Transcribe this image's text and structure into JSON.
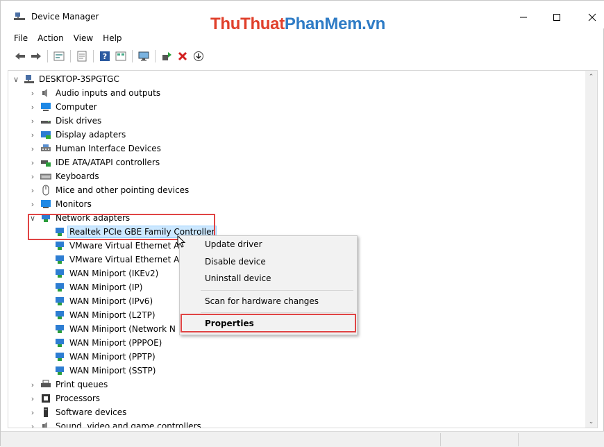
{
  "window": {
    "title": "Device Manager",
    "watermark_part1": "ThuThuat",
    "watermark_part2": "PhanMem.vn"
  },
  "menu": [
    "File",
    "Action",
    "View",
    "Help"
  ],
  "toolbar": {
    "icons": [
      "back-arrow-icon",
      "forward-arrow-icon",
      "properties-icon",
      "show-hide-icon",
      "help-icon",
      "view-icon",
      "monitor-icon",
      "update-driver-icon",
      "uninstall-icon",
      "scan-hardware-icon"
    ]
  },
  "tree": {
    "root": "DESKTOP-3SPGTGC",
    "categories": [
      {
        "label": "Audio inputs and outputs",
        "icon": "speaker-icon",
        "expanded": false
      },
      {
        "label": "Computer",
        "icon": "computer-icon",
        "expanded": false
      },
      {
        "label": "Disk drives",
        "icon": "disk-drive-icon",
        "expanded": false
      },
      {
        "label": "Display adapters",
        "icon": "display-adapter-icon",
        "expanded": false
      },
      {
        "label": "Human Interface Devices",
        "icon": "hid-icon",
        "expanded": false
      },
      {
        "label": "IDE ATA/ATAPI controllers",
        "icon": "ide-controller-icon",
        "expanded": false
      },
      {
        "label": "Keyboards",
        "icon": "keyboard-icon",
        "expanded": false
      },
      {
        "label": "Mice and other pointing devices",
        "icon": "mouse-icon",
        "expanded": false
      },
      {
        "label": "Monitors",
        "icon": "monitor-icon",
        "expanded": false
      },
      {
        "label": "Network adapters",
        "icon": "network-adapter-icon",
        "expanded": true
      }
    ],
    "network_adapters": [
      {
        "label": "Realtek PCIe GBE Family Controller",
        "selected": true
      },
      {
        "label": "VMware Virtual Ethernet A",
        "selected": false
      },
      {
        "label": "VMware Virtual Ethernet A",
        "selected": false
      },
      {
        "label": "WAN Miniport (IKEv2)",
        "selected": false
      },
      {
        "label": "WAN Miniport (IP)",
        "selected": false
      },
      {
        "label": "WAN Miniport (IPv6)",
        "selected": false
      },
      {
        "label": "WAN Miniport (L2TP)",
        "selected": false
      },
      {
        "label": "WAN Miniport (Network N",
        "selected": false
      },
      {
        "label": "WAN Miniport (PPPOE)",
        "selected": false
      },
      {
        "label": "WAN Miniport (PPTP)",
        "selected": false
      },
      {
        "label": "WAN Miniport (SSTP)",
        "selected": false
      }
    ],
    "categories_after": [
      {
        "label": "Print queues",
        "icon": "printer-icon"
      },
      {
        "label": "Processors",
        "icon": "processor-icon"
      },
      {
        "label": "Software devices",
        "icon": "software-device-icon"
      },
      {
        "label": "Sound, video and game controllers",
        "icon": "sound-icon"
      }
    ]
  },
  "context_menu": {
    "items": [
      "Update driver",
      "Disable device",
      "Uninstall device",
      "Scan for hardware changes",
      "Properties"
    ]
  },
  "colors": {
    "selection_bg": "#cce8ff",
    "highlight_box": "#e04444",
    "watermark_red": "#e0402b",
    "watermark_blue": "#2f7cc6"
  }
}
